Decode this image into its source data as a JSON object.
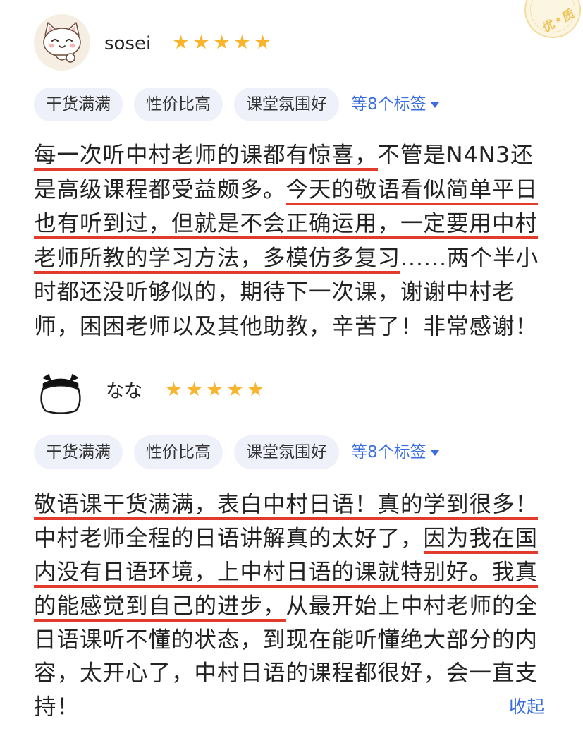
{
  "badge": {
    "chars": [
      "优",
      "质"
    ],
    "icon": "star-icon"
  },
  "colors": {
    "accent": "#3a6ee0",
    "star": "#f7b42c",
    "underline": "#e33b2b",
    "tag_bg": "#eef1f9",
    "text": "#222222"
  },
  "reviews": [
    {
      "username": "sosei",
      "avatar": "cat-avatar",
      "rating": 5,
      "tags": [
        "干货满满",
        "性价比高",
        "课堂氛围好"
      ],
      "more_tags": "等8个标签",
      "lines": [
        [
          {
            "text": "每一次听中村老师的课都有惊喜，",
            "underlined": true
          },
          {
            "text": "不管是N4N3还",
            "underlined": false
          }
        ],
        [
          {
            "text": "是高级课程都受益颇多。",
            "underlined": false
          },
          {
            "text": "今天的敬语看似简单平日",
            "underlined": true
          }
        ],
        [
          {
            "text": "也有听到过，但就是不会正确运用，一定要用中村",
            "underlined": true
          }
        ],
        [
          {
            "text": "老师所教的学习方法，多模仿多复习",
            "underlined": true
          },
          {
            "text": "......两个半小",
            "underlined": false
          }
        ],
        [
          {
            "text": "时都还没听够似的，期待下一次课，谢谢中村老",
            "underlined": false
          }
        ],
        [
          {
            "text": "师，困困老师以及其他助教，辛苦了！非常感谢！",
            "underlined": false
          }
        ]
      ]
    },
    {
      "username": "なな",
      "avatar": "panda-avatar",
      "rating": 5,
      "tags": [
        "干货满满",
        "性价比高",
        "课堂氛围好"
      ],
      "more_tags": "等8个标签",
      "lines": [
        [
          {
            "text": "敬语课干货满满，表白中村日语！真的学到很多！",
            "underlined": true
          }
        ],
        [
          {
            "text": "中村老师全程的日语讲解真的太好了，",
            "underlined": false
          },
          {
            "text": "因为我在国",
            "underlined": true
          }
        ],
        [
          {
            "text": "内没有日语环境，上中村日语的课就特别好。我真",
            "underlined": true
          }
        ],
        [
          {
            "text": "的能感觉到自己的进步，",
            "underlined": true
          },
          {
            "text": "从最开始上中村老师的全",
            "underlined": false
          }
        ],
        [
          {
            "text": "日语课听不懂的状态，到现在能听懂绝大部分的内",
            "underlined": false
          }
        ],
        [
          {
            "text": "容，太开心了，中村日语的课程都很好，会一直支",
            "underlined": false
          }
        ],
        [
          {
            "text": "持！",
            "underlined": false
          }
        ]
      ],
      "collapse_label": "收起"
    }
  ]
}
